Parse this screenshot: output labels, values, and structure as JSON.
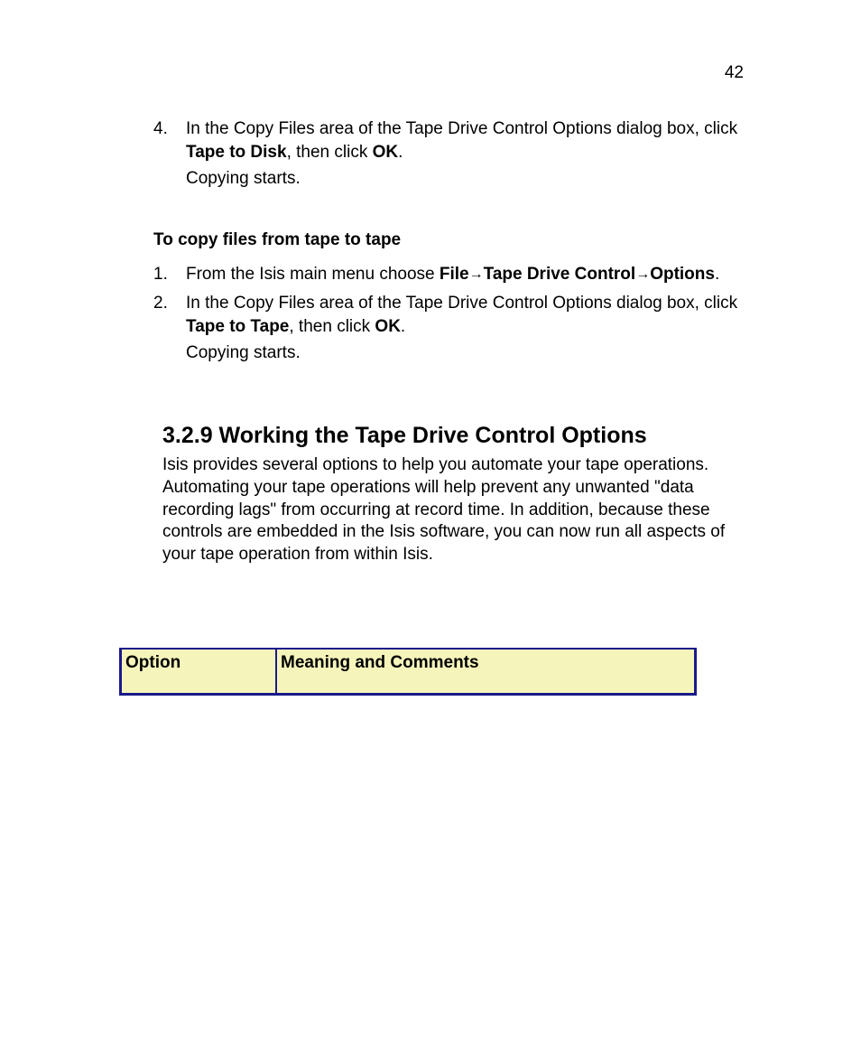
{
  "pageNumber": "42",
  "list1": {
    "item4": {
      "num": "4.",
      "pre": "In the Copy Files area of the Tape Drive Control Options dialog box, click ",
      "bold1": "Tape to Disk",
      "mid": ", then click ",
      "bold2": "OK",
      "post": ".",
      "sub": "Copying starts."
    }
  },
  "subHeading": "To copy files from tape to tape",
  "list2": {
    "item1": {
      "num": "1.",
      "pre": "From the Isis main menu choose ",
      "bold1": "File",
      "arrow1": "→",
      "bold2": "Tape Drive Control",
      "arrow2": "→",
      "bold3": "Options",
      "post": "."
    },
    "item2": {
      "num": "2.",
      "pre": "In the Copy Files area of the Tape Drive Control Options dialog box, click ",
      "bold1": "Tape to Tape",
      "mid": ", then click ",
      "bold2": "OK",
      "post": ".",
      "sub": "Copying starts."
    }
  },
  "section": {
    "heading": "3.2.9 Working the Tape Drive Control Options",
    "body": "Isis provides several options to help you automate your tape operations. Automating your tape operations will help prevent any unwanted \"data recording lags\" from occurring at record time. In addition, because these controls are embedded in the Isis software, you can now run all aspects of your tape operation from within Isis."
  },
  "table": {
    "header": {
      "col1": "Option",
      "col2": "Meaning and Comments"
    }
  }
}
